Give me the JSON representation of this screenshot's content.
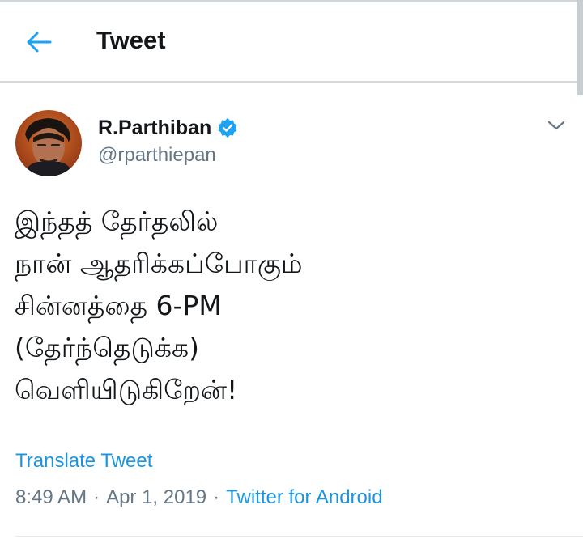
{
  "header": {
    "back_icon": "arrow-left-icon",
    "title": "Tweet"
  },
  "tweet": {
    "author": {
      "display_name": "R.Parthiban",
      "handle": "@rparthiepan",
      "verified": true
    },
    "text_lines": [
      "இந்தத் தேர்தலில்",
      "நான் ஆதரிக்கப்போகும்",
      "சின்னத்தை 6-PM",
      "(தேர்ந்தெடுக்க)",
      "வெளியிடுகிறேன்!"
    ],
    "translate_label": "Translate Tweet",
    "meta": {
      "time": "8:49 AM",
      "separator": "·",
      "date": "Apr 1, 2019",
      "source": "Twitter for Android"
    }
  },
  "colors": {
    "accent": "#1b95e0",
    "secondary_text": "#657786",
    "primary_text": "#14171a",
    "verified_badge": "#1da1f2"
  }
}
